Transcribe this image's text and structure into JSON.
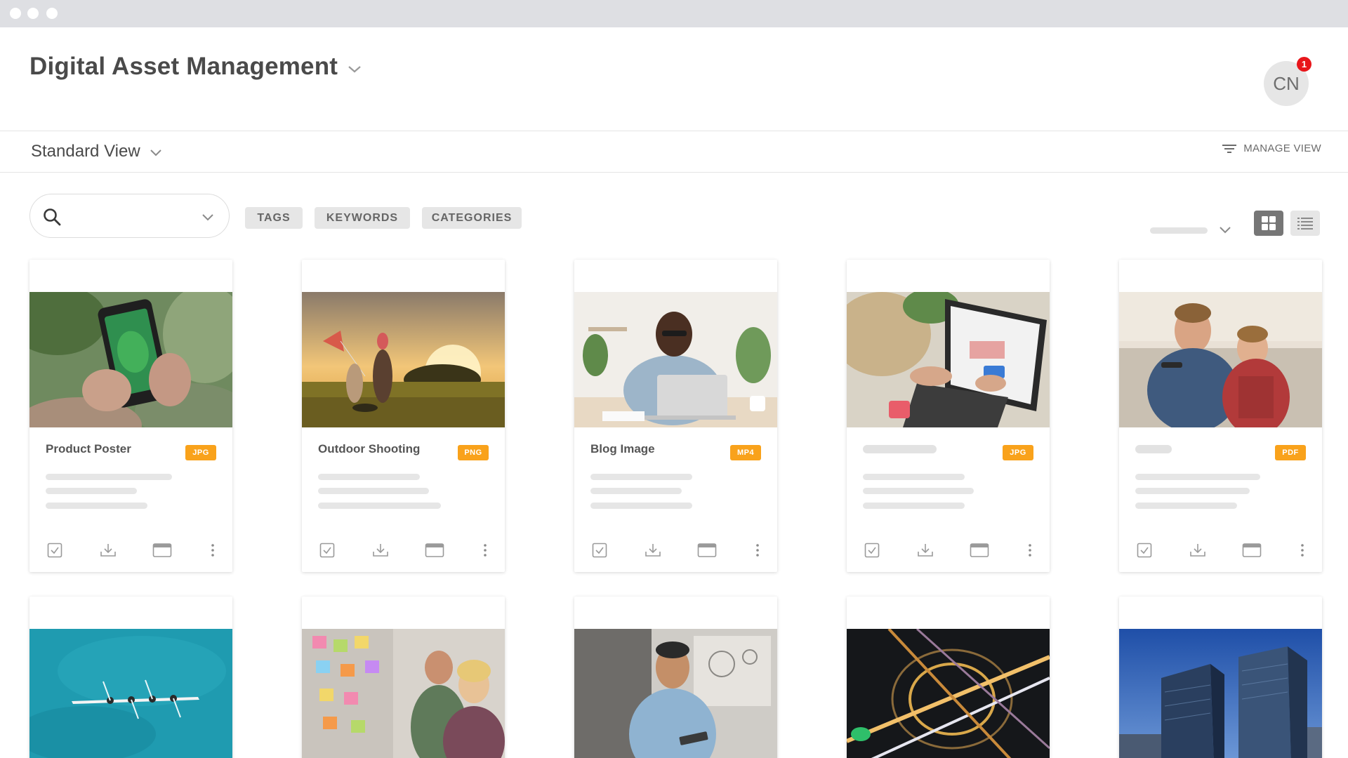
{
  "window": {
    "controls": [
      "close",
      "minimize",
      "maximize"
    ]
  },
  "header": {
    "app_title": "Digital Asset Management",
    "avatar_initials": "CN",
    "notification_count": "1"
  },
  "viewbar": {
    "view_label": "Standard View",
    "manage_view_label": "MANAGE VIEW"
  },
  "toolbar": {
    "search_value": "",
    "filters": [
      "TAGS",
      "KEYWORDS",
      "CATEGORIES"
    ],
    "layout_mode": "grid"
  },
  "assets": [
    {
      "title": "Product Poster",
      "type": "JPG",
      "image": "hands-holding-phone-photographing-plant"
    },
    {
      "title": "Outdoor Shooting",
      "type": "PNG",
      "image": "family-running-with-kite-at-sunset"
    },
    {
      "title": "Blog Image",
      "type": "MP4",
      "image": "man-smiling-at-laptop"
    },
    {
      "title": "",
      "type": "JPG",
      "image": "woman-shopping-online-with-card"
    },
    {
      "title": "",
      "type": "PDF",
      "image": "father-and-son-on-couch"
    },
    {
      "title": "",
      "type": "",
      "image": "rowing-boat-aerial-ocean"
    },
    {
      "title": "",
      "type": "",
      "image": "team-with-sticky-notes-on-glass"
    },
    {
      "title": "",
      "type": "",
      "image": "man-smiling-with-tablet"
    },
    {
      "title": "",
      "type": "",
      "image": "highway-interchange-at-night"
    },
    {
      "title": "",
      "type": "",
      "image": "glass-skyscrapers-blue-sky"
    }
  ],
  "card_actions": [
    "select-checkbox-icon",
    "download-icon",
    "preview-window-icon",
    "more-options-icon"
  ],
  "colors": {
    "badge": "#f9a21b",
    "chip_bg": "#e6e6e6",
    "notification": "#e8161b",
    "active_toggle": "#767676"
  }
}
